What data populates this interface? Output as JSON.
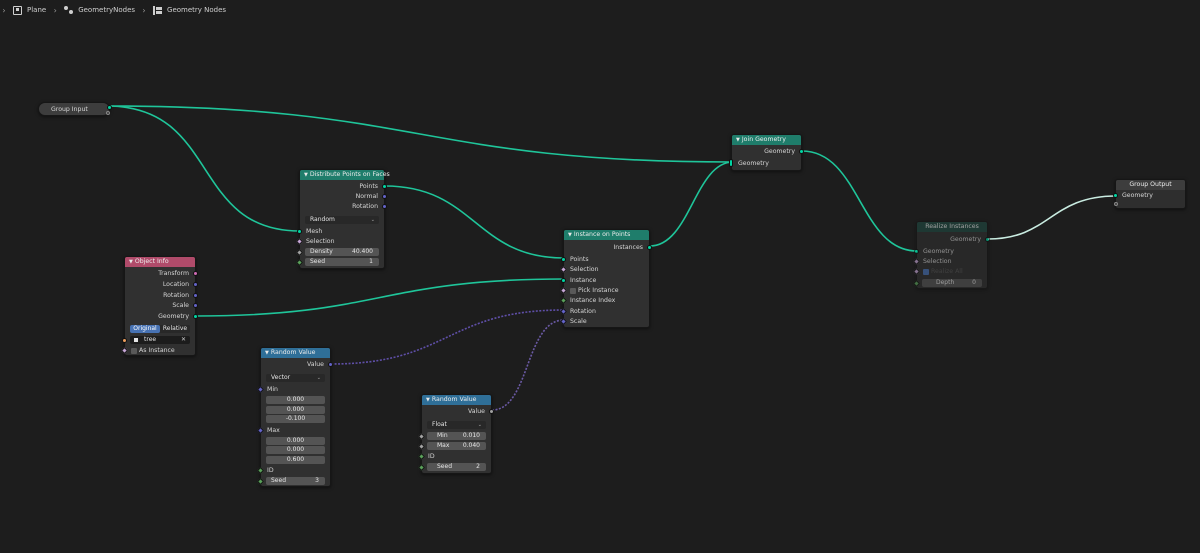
{
  "breadcrumb": {
    "items": [
      {
        "label": "Plane",
        "icon": "object-icon"
      },
      {
        "label": "GeometryNodes",
        "icon": "modifier-icon"
      },
      {
        "label": "Geometry Nodes",
        "icon": "node-tree-icon"
      }
    ]
  },
  "colors": {
    "background": "#1d1d1d",
    "geometry_header": "#1f7d6b",
    "input_header": "#b04b6a",
    "converter_header": "#2f6f98",
    "geometry_wire": "#00d6a3",
    "vector_wire": "#6363c7",
    "float_wire": "#a1a1a1",
    "active_toggle": "#4772b3"
  },
  "nodes": {
    "group_input": {
      "title": "Group Input"
    },
    "join_geometry": {
      "title": "Join Geometry",
      "out_geometry": "Geometry",
      "in_geometry": "Geometry"
    },
    "group_output": {
      "title": "Group Output",
      "in_geometry": "Geometry"
    },
    "distribute": {
      "title": "Distribute Points on Faces",
      "out_points": "Points",
      "out_normal": "Normal",
      "out_rotation": "Rotation",
      "mode": "Random",
      "in_mesh": "Mesh",
      "in_selection": "Selection",
      "density_label": "Density",
      "density_value": "40.400",
      "seed_label": "Seed",
      "seed_value": "1"
    },
    "object_info": {
      "title": "Object Info",
      "out_transform": "Transform",
      "out_location": "Location",
      "out_rotation": "Rotation",
      "out_scale": "Scale",
      "out_geometry": "Geometry",
      "toggle_original": "Original",
      "toggle_relative": "Relative",
      "object_name": "tree",
      "as_instance": "As Instance"
    },
    "instance_on_points": {
      "title": "Instance on Points",
      "out_instances": "Instances",
      "in_points": "Points",
      "in_selection": "Selection",
      "in_instance": "Instance",
      "pick_instance": "Pick Instance",
      "in_instance_index": "Instance Index",
      "in_rotation": "Rotation",
      "in_scale": "Scale"
    },
    "realize_instances": {
      "title": "Realize Instances",
      "out_geometry": "Geometry",
      "in_geometry": "Geometry",
      "in_selection": "Selection",
      "in_realize_all": "Realize All",
      "depth_label": "Depth",
      "depth_value": "0"
    },
    "random_vector": {
      "title": "Random Value",
      "out_value": "Value",
      "type": "Vector",
      "min_label": "Min",
      "min_values": [
        "0.000",
        "0.000",
        "-0.100"
      ],
      "max_label": "Max",
      "max_values": [
        "0.000",
        "0.000",
        "0.600"
      ],
      "id_label": "ID",
      "seed_label": "Seed",
      "seed_value": "3"
    },
    "random_float": {
      "title": "Random Value",
      "out_value": "Value",
      "type": "Float",
      "min_label": "Min",
      "min_value": "0.010",
      "max_label": "Max",
      "max_value": "0.040",
      "id_label": "ID",
      "seed_label": "Seed",
      "seed_value": "2"
    }
  }
}
